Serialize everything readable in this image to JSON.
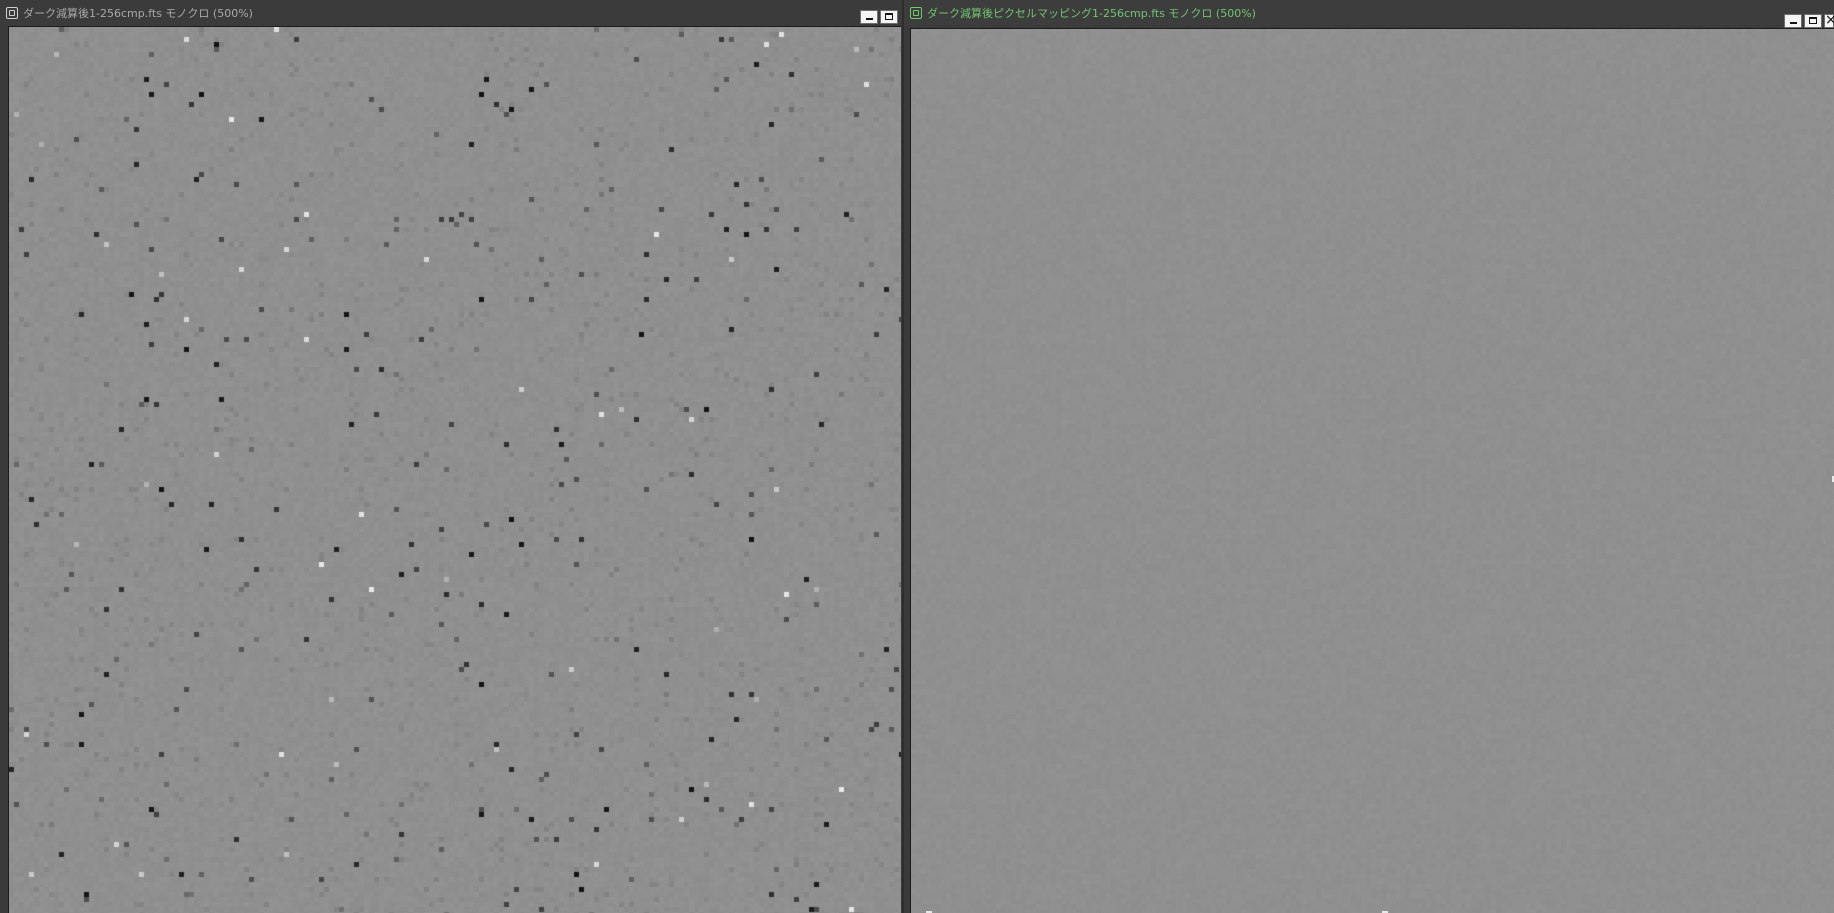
{
  "windows": [
    {
      "id": "left",
      "title": "ダーク減算後1-256cmp.fts モノクロ (500%)",
      "icon": "image-window-icon",
      "active": false,
      "image": {
        "background_gray": 143,
        "noise_level": 3,
        "outlier_density": 0.012,
        "dark_specks": true,
        "bright_specks": true
      }
    },
    {
      "id": "right",
      "title": "ダーク減算後ピクセルマッピング1-256cmp.fts モノクロ (500%)",
      "icon": "image-window-icon",
      "active": true,
      "image": {
        "background_gray": 143,
        "noise_level": 2,
        "outlier_density": 0,
        "dark_specks": false,
        "bright_specks": false
      }
    }
  ],
  "colors": {
    "inactive_title": "#a8a8a8",
    "active_title": "#71c471",
    "titlebar_bg": "#3b3b3b",
    "image_bg": "#8f8f8f"
  }
}
